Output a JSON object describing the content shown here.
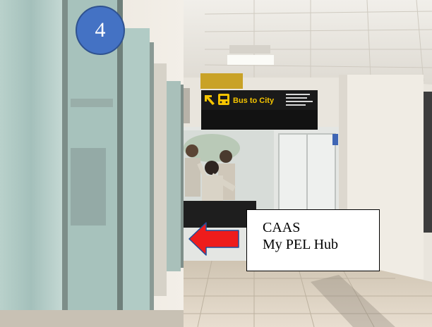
{
  "step_badge": {
    "number": "4",
    "color": "#4472c4"
  },
  "callout": {
    "line1": "CAAS",
    "line2": "My PEL Hub"
  },
  "arrow": {
    "direction": "left",
    "color": "#ee1c1c"
  },
  "overhead_sign": {
    "label": "Bus to City",
    "background": "#1a1a1a",
    "text_color": "#f5c400",
    "icons": [
      "arrow-up-left-icon",
      "bus-icon"
    ]
  }
}
